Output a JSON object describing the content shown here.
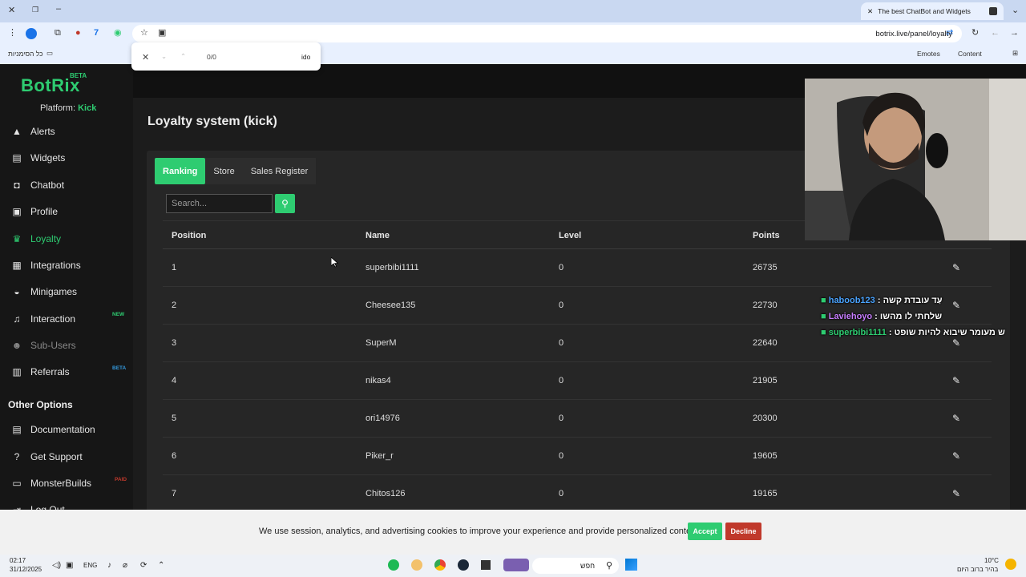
{
  "browser": {
    "tab_title": "The best ChatBot and Widgets",
    "url": "botrix.live/panel/loyalty",
    "bookmarks": {
      "all_bookmarks": "כל הסימניות",
      "emotes": "Emotes",
      "content": "Content"
    },
    "find": {
      "count": "0/0",
      "query": "ido"
    }
  },
  "sidebar": {
    "logo": "BotRix",
    "logo_badge": "BETA",
    "platform_label": "Platform:",
    "platform_value": "Kick",
    "items": [
      {
        "label": "Alerts",
        "icon": "alert-icon"
      },
      {
        "label": "Widgets",
        "icon": "widgets-icon"
      },
      {
        "label": "Chatbot",
        "icon": "robot-icon"
      },
      {
        "label": "Profile",
        "icon": "profile-card-icon"
      },
      {
        "label": "Loyalty",
        "icon": "trophy-icon"
      },
      {
        "label": "Integrations",
        "icon": "integrations-icon"
      },
      {
        "label": "Minigames",
        "icon": "gamepad-icon"
      },
      {
        "label": "Interaction",
        "icon": "music-note-icon",
        "badge": "NEW"
      },
      {
        "label": "Sub-Users",
        "icon": "users-icon"
      },
      {
        "label": "Referrals",
        "icon": "referrals-icon",
        "badge": "BETA"
      }
    ],
    "other_options_title": "Other Options",
    "other_items": [
      {
        "label": "Documentation",
        "icon": "book-icon"
      },
      {
        "label": "Get Support",
        "icon": "help-icon"
      },
      {
        "label": "MonsterBuilds",
        "icon": "monitor-icon",
        "badge": "PAID"
      },
      {
        "label": "Log Out",
        "icon": "logout-icon"
      }
    ]
  },
  "main": {
    "title": "Loyalty system (kick)",
    "tabs": [
      "Ranking",
      "Store",
      "Sales Register"
    ],
    "search_placeholder": "Search...",
    "columns": [
      "Position",
      "Name",
      "Level",
      "Points"
    ],
    "rows": [
      {
        "position": "1",
        "name": "superbibi1111",
        "level": "0",
        "points": "26735"
      },
      {
        "position": "2",
        "name": "Cheesee135",
        "level": "0",
        "points": "22730"
      },
      {
        "position": "3",
        "name": "SuperM",
        "level": "0",
        "points": "22640"
      },
      {
        "position": "4",
        "name": "nikas4",
        "level": "0",
        "points": "21905"
      },
      {
        "position": "5",
        "name": "ori14976",
        "level": "0",
        "points": "20300"
      },
      {
        "position": "6",
        "name": "Piker_r",
        "level": "0",
        "points": "19605"
      },
      {
        "position": "7",
        "name": "Chitos126",
        "level": "0",
        "points": "19165"
      }
    ]
  },
  "chat_overlay": [
    {
      "user": "haboob123",
      "user_color": "#4aa3ff",
      "message": "עַד עובדת קשה"
    },
    {
      "user": "Laviehoyo",
      "user_color": "#c77dff",
      "message": "שלחתי לו מהשו"
    },
    {
      "user": "superbibi1111",
      "user_color": "#2ecc71",
      "message": "ש מעומר שיבוא להיות שופט"
    }
  ],
  "cookie": {
    "text": "We use session, analytics, and advertising cookies to improve your experience and provide personalized content.",
    "accept": "Accept",
    "decline": "Decline"
  },
  "taskbar": {
    "time": "02:17",
    "date": "31/12/2025",
    "lang": "ENG",
    "search": "חפש",
    "weather_temp": "10°C",
    "weather_desc": "בהיר ברוב היום"
  },
  "colors": {
    "accent": "#2ecc71",
    "decline": "#c0392b",
    "background": "#1c1c1c"
  }
}
